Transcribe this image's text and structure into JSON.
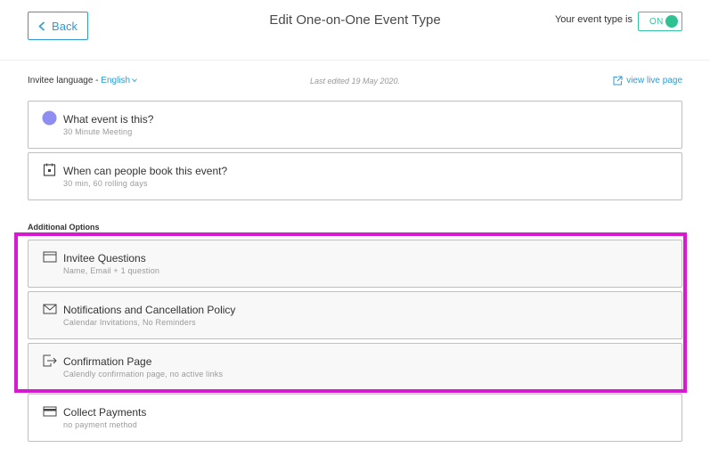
{
  "header": {
    "back_label": "Back",
    "title": "Edit One-on-One Event Type",
    "status_label": "Your event type is",
    "toggle_label": "ON"
  },
  "meta": {
    "language_prefix": "Invitee language - ",
    "language_value": "English",
    "last_edited": "Last edited 19 May 2020.",
    "live_link": "view live page"
  },
  "cards": [
    {
      "title": "What event is this?",
      "subtitle": "30 Minute Meeting",
      "icon": "purple-circle-icon"
    },
    {
      "title": "When can people book this event?",
      "subtitle": "30 min, 60 rolling days",
      "icon": "calendar-icon"
    }
  ],
  "additional": {
    "label": "Additional Options",
    "items": [
      {
        "title": "Invitee Questions",
        "subtitle": "Name, Email + 1 question",
        "icon": "form-icon"
      },
      {
        "title": "Notifications and Cancellation Policy",
        "subtitle": "Calendar Invitations, No Reminders",
        "icon": "envelope-icon"
      },
      {
        "title": "Confirmation Page",
        "subtitle": "Calendly confirmation page, no active links",
        "icon": "exit-arrow-icon"
      },
      {
        "title": "Collect Payments",
        "subtitle": "no payment method",
        "icon": "credit-card-icon"
      }
    ]
  },
  "colors": {
    "accent": "#2f9bd4",
    "toggle_green": "#2ec192",
    "event_color": "#8d8df2",
    "highlight": "#d919d2"
  }
}
